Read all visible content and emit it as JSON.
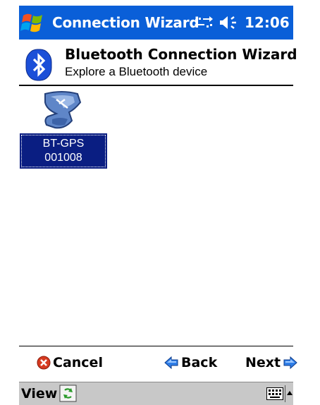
{
  "titlebar": {
    "title": "Connection Wizard",
    "clock": "12:06",
    "start_icon": "windows-flag-icon",
    "connectivity_icon": "connectivity-arrows-icon",
    "volume_icon": "speaker-icon",
    "color": "#0a5fd8"
  },
  "header": {
    "title": "Bluetooth Connection Wizard",
    "subtitle": "Explore a Bluetooth device",
    "logo_icon": "bluetooth-icon"
  },
  "devices": [
    {
      "name": "BT-GPS",
      "id": "001008",
      "icon": "bluetooth-device-icon",
      "selected": true,
      "selection_color": "#0a1e82"
    }
  ],
  "navigation": {
    "cancel_label": "Cancel",
    "back_label": "Back",
    "next_label": "Next"
  },
  "menubar": {
    "view_label": "View",
    "refresh_icon": "refresh-icon",
    "keyboard_icon": "keyboard-icon",
    "sip_arrow_icon": "up-arrow-icon"
  }
}
